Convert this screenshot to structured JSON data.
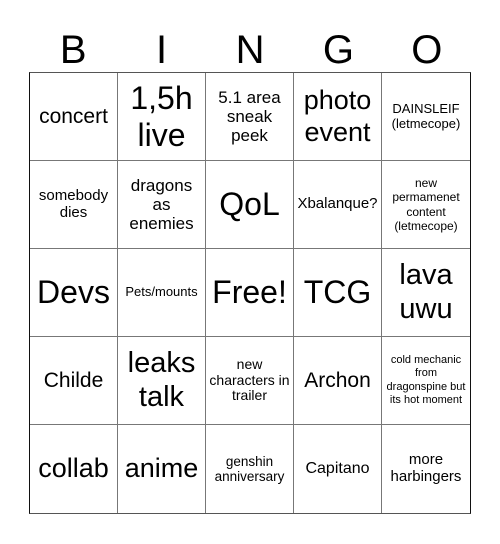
{
  "header": {
    "letters": [
      "B",
      "I",
      "N",
      "G",
      "O"
    ]
  },
  "cells": [
    "concert",
    "1,5h live",
    "5.1 area sneak peek",
    "photo event",
    "DAINSLEIF (letmecope)",
    "somebody dies",
    "dragons as enemies",
    "QoL",
    "Xbalanque?",
    "new permamenet content (letmecope)",
    "Devs",
    "Pets/mounts",
    "Free!",
    "TCG",
    "lava uwu",
    "Childe",
    "leaks talk",
    "new characters in trailer",
    "Archon",
    "cold mechanic from dragonspine but its hot moment",
    "collab",
    "anime",
    "genshin anniversary",
    "Capitano",
    "more harbingers"
  ]
}
